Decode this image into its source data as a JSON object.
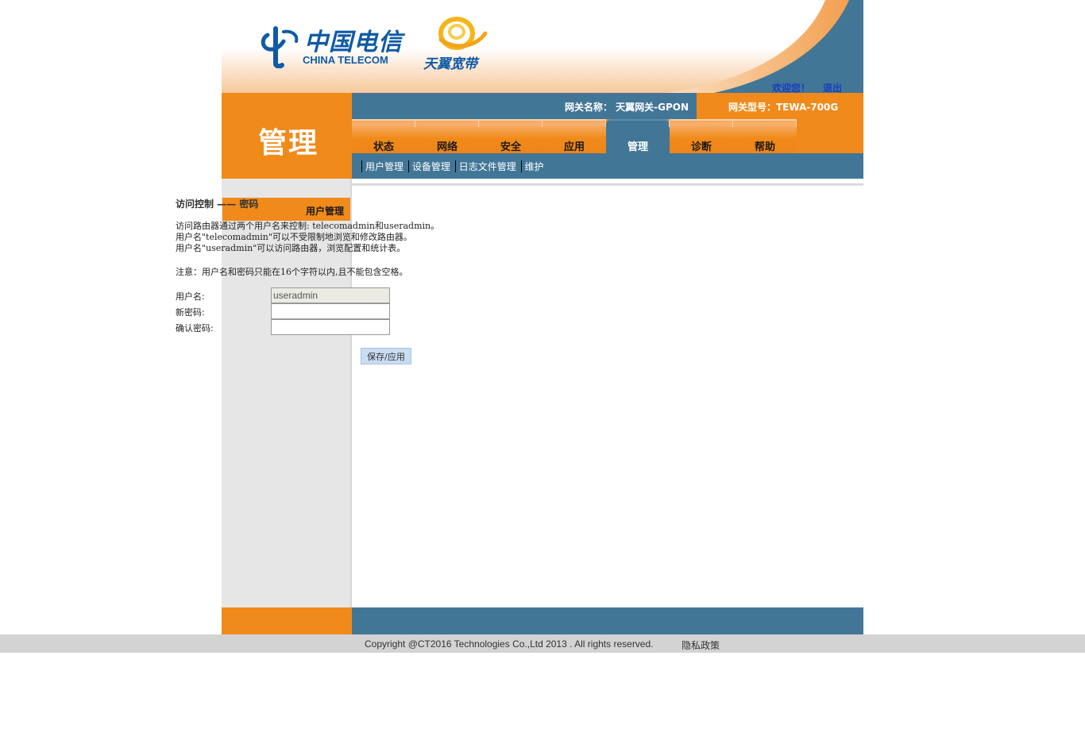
{
  "header": {
    "brand_cn": "中国电信",
    "brand_en": "CHINA TELECOM",
    "product_logo": "天翼宽带",
    "welcome": "欢迎您！",
    "logout": "退出"
  },
  "band": {
    "page_title": "管理",
    "gateway_name": "网关名称： 天翼网关-GPON",
    "gateway_model": "网关型号：TEWA-700G"
  },
  "nav": {
    "tabs": [
      {
        "label": "状态"
      },
      {
        "label": "网络"
      },
      {
        "label": "安全"
      },
      {
        "label": "应用"
      },
      {
        "label": "管理"
      },
      {
        "label": "诊断"
      },
      {
        "label": "帮助"
      }
    ],
    "active_tab": "管理"
  },
  "subnav": {
    "items": [
      "用户管理",
      "设备管理",
      "日志文件管理",
      "维护"
    ]
  },
  "sidebar": {
    "items": [
      "用户管理"
    ]
  },
  "content": {
    "title": "访问控制 —— 密码",
    "desc_lines": [
      "访问路由器通过两个用户名来控制: telecomadmin和useradmin。",
      "用户名\"telecomadmin\"可以不受限制地浏览和修改路由器。",
      "用户名\"useradmin\"可以访问路由器，浏览配置和统计表。"
    ],
    "note": "注意：用户名和密码只能在16个字符以内,且不能包含空格。",
    "form": {
      "username_label": "用户名:",
      "username_value": "useradmin",
      "new_password_label": "新密码:",
      "confirm_password_label": "确认密码:"
    },
    "save_button": "保存/应用"
  },
  "footer": {
    "copyright": "Copyright @CT2016 Technologies Co.,Ltd 2013 . All rights reserved.",
    "privacy": "隐私政策"
  },
  "colors": {
    "orange": "#f08a1a",
    "steel_blue": "#427697",
    "brand_blue": "#0f5aa6",
    "sidebar_gray": "#e6e6e6"
  }
}
